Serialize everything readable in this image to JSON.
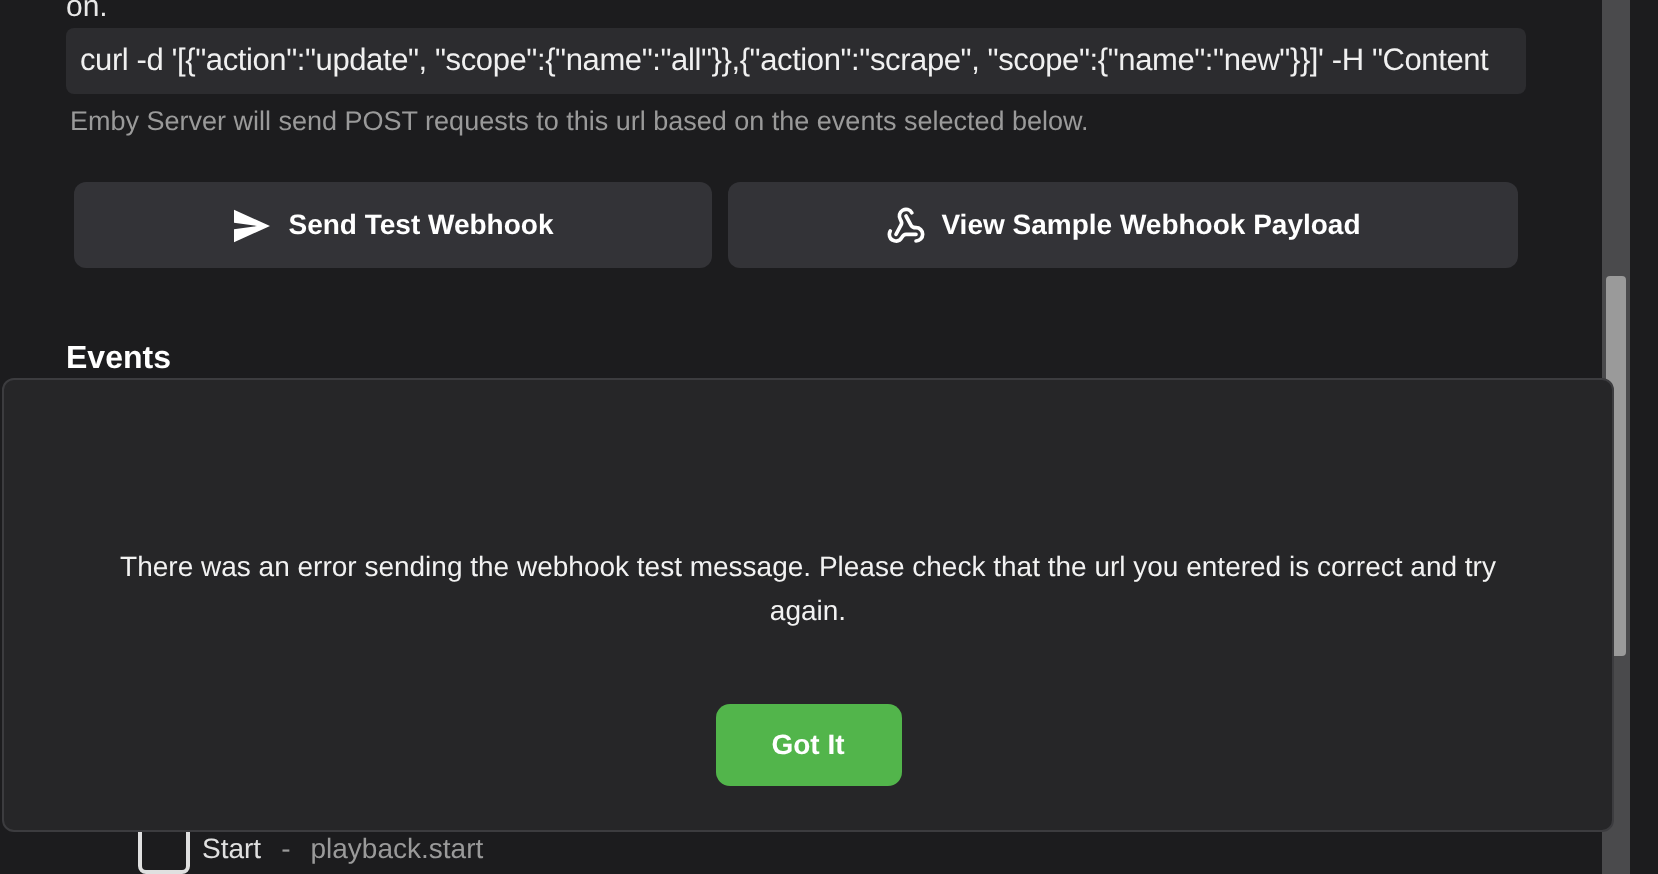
{
  "url_field_label_tail": "on.",
  "url_field": {
    "value": "curl -d '[{\"action\":\"update\", \"scope\":{\"name\":\"all\"}},{\"action\":\"scrape\", \"scope\":{\"name\":\"new\"}}]' -H \"Content"
  },
  "url_help": "Emby Server will send POST requests to this url based on the events selected below.",
  "buttons": [
    {
      "label": "Send Test Webhook",
      "kind": "send"
    },
    {
      "label": "View Sample Webhook Payload",
      "kind": "sample"
    }
  ],
  "events": {
    "title": "Events",
    "items": [
      {
        "label": "Start",
        "separator": "-",
        "event": "playback.start",
        "checked": false
      }
    ]
  },
  "dialog": {
    "message": "There was an error sending the webhook test message. Please check that the url you entered is correct and try again.",
    "button": "Got It"
  }
}
